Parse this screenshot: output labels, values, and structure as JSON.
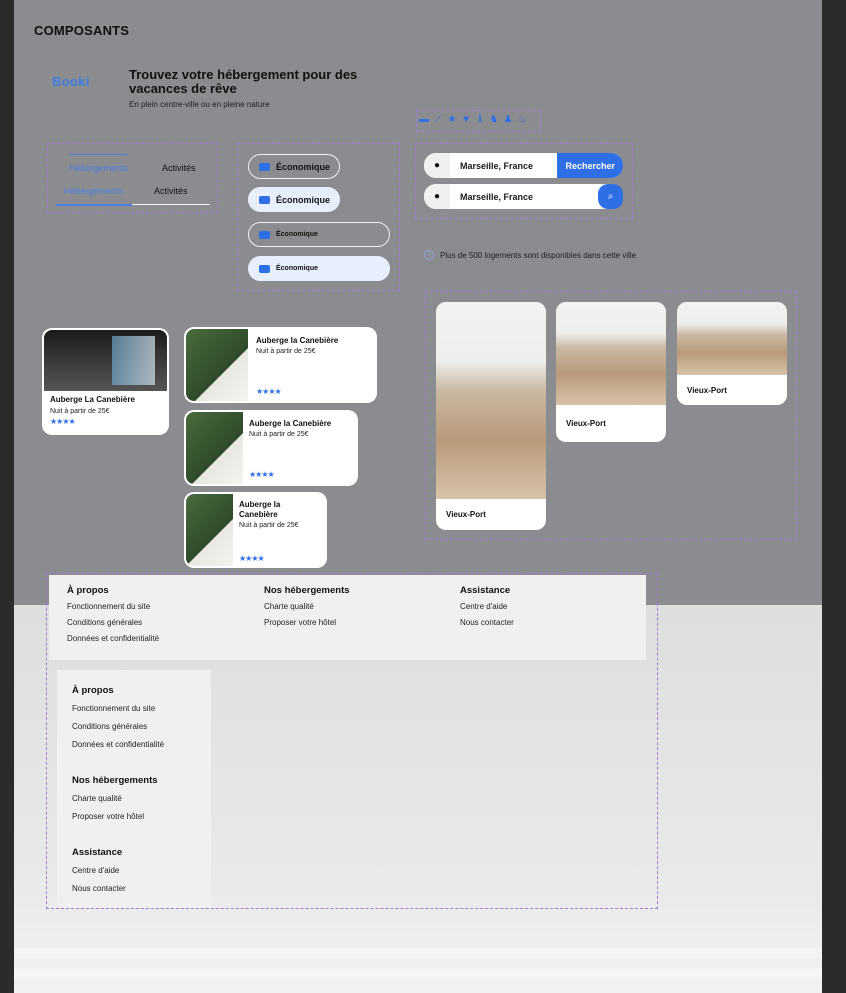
{
  "section_title": "COMPOSANTS",
  "header": {
    "logo": "Booki",
    "headline": "Trouvez votre hébergement pour des vacances de rêve",
    "subline": "En plein centre-ville ou en pleine nature"
  },
  "icons": [
    "money-icon",
    "chart-icon",
    "star-icon",
    "heart-icon",
    "info-icon",
    "dog-icon",
    "person-icon",
    "fire-icon"
  ],
  "tabs": [
    {
      "left": "Hébergements",
      "right": "Activités"
    },
    {
      "left": "Hébergements",
      "right": "Activités"
    }
  ],
  "filters": [
    "Économique",
    "Économique",
    "Économique",
    "Économique"
  ],
  "search": {
    "city": "Marseille, France",
    "button_label": "Rechercher",
    "pin_icon": "●",
    "magnifier_icon": "⌕"
  },
  "info_text": "Plus de 500 logements sont disponibles dans cette ville",
  "cards": {
    "vertical": {
      "name": "Auberge La Canebière",
      "price": "Nuit à partir de 25€",
      "stars": "★★★★"
    },
    "horizontal": [
      {
        "name": "Auberge la Canebière",
        "price": "Nuit à partir de 25€",
        "stars": "★★★★"
      },
      {
        "name": "Auberge la Canebière",
        "price": "Nuit à partir de 25€",
        "stars": "★★★★"
      },
      {
        "name": "Auberge la Canebière",
        "price": "Nuit à partir de 25€",
        "stars": "★★★★"
      }
    ]
  },
  "destinations": [
    "Vieux-Port",
    "Vieux-Port",
    "Vieux-Port"
  ],
  "footer": {
    "columns": [
      {
        "title": "À propos",
        "links": [
          "Fonctionnement du site",
          "Conditions générales",
          "Données et confidentialité"
        ]
      },
      {
        "title": "Nos hébergements",
        "links": [
          "Charte qualité",
          "Proposer votre hôtel"
        ]
      },
      {
        "title": "Assistance",
        "links": [
          "Centre d'aide",
          "Nous contacter"
        ]
      }
    ]
  },
  "colors": {
    "accent": "#2f6fe6",
    "dashed": "#9b7fd9"
  }
}
